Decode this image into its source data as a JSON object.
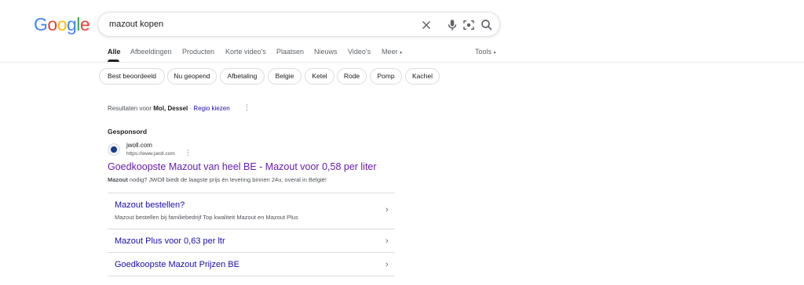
{
  "logo": {
    "text": "Google"
  },
  "search": {
    "query": "mazout kopen"
  },
  "tabs": [
    {
      "label": "Alle"
    },
    {
      "label": "Afbeeldingen"
    },
    {
      "label": "Producten"
    },
    {
      "label": "Korte video's"
    },
    {
      "label": "Plaatsen"
    },
    {
      "label": "Nieuws"
    },
    {
      "label": "Video's"
    },
    {
      "label": "Meer"
    }
  ],
  "tools": {
    "label": "Tools"
  },
  "chips": [
    {
      "label": "Best beoordeeld"
    },
    {
      "label": "Nu geopend"
    },
    {
      "label": "Afbetaling"
    },
    {
      "label": "Belgie"
    },
    {
      "label": "Ketel"
    },
    {
      "label": "Rode"
    },
    {
      "label": "Pomp"
    },
    {
      "label": "Kachel"
    }
  ],
  "location": {
    "prefix": "Resultaten voor",
    "place": "Mol, Dessel",
    "separator": "·",
    "link": "Regio kiezen"
  },
  "ad": {
    "sponsored_label": "Gesponsord",
    "site_name": "jwoll.com",
    "site_url": "https://www.jwoll.com",
    "title": "Goedkoopste Mazout van heel BE - Mazout voor 0,58 per liter",
    "desc_bold": "Mazout",
    "desc_rest": " nodig? JWOll biedt de laagste prijs én levering binnen 24u, overal in België!",
    "sitelinks": [
      {
        "title": "Mazout bestellen?",
        "desc": "Mazout bestellen bij familiebedrijf Top kwaliteit Mazout en Mazout Plus"
      },
      {
        "title": "Mazout Plus voor 0,63 per ltr",
        "desc": ""
      },
      {
        "title": "Goedkoopste Mazout Prijzen BE",
        "desc": ""
      }
    ]
  }
}
